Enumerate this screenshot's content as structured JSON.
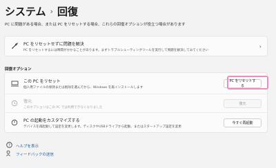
{
  "header": {
    "crumb": "システム",
    "separator": "›",
    "title": "回復"
  },
  "intro": "PC に問題がある場合、または PC をリセットする場合、これらの回復オプションが役立つ場合があります",
  "fix_card": {
    "title": "PC をリセットせずに問題を解決",
    "subtitle": "PC をリセットするには時間がかかることがあります。まずトラブルシューティングツールを実行して問題を解決してみてください"
  },
  "section_title": "回復オプション",
  "options": [
    {
      "title": "この PC をリセット",
      "subtitle": "個人用ファイルの保持または削除を選んでから、Windows を再インストールします",
      "button": "PC をリセットする",
      "enabled": true
    },
    {
      "title": "復元",
      "subtitle": "このオプションはこの PC では利用できなくなりました",
      "button": "復元",
      "enabled": false
    },
    {
      "title": "PC の起動をカスタマイズする",
      "subtitle": "デバイスを再起動して設定を変更します。ディスクやUSBドライブから起動、またはスタートアップ設定を変更",
      "button": "今すぐ再起動",
      "enabled": true
    }
  ],
  "links": {
    "help": "ヘルプを表示",
    "feedback": "フィードバックの送信"
  },
  "colors": {
    "highlight": "#e88fbf",
    "link": "#1d5fa8"
  }
}
